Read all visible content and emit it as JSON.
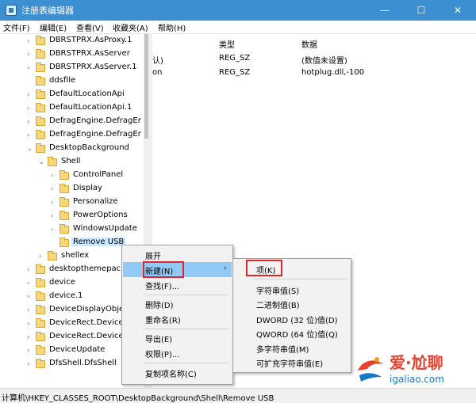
{
  "window": {
    "title": "注册表编辑器",
    "minimize_glyph": "—",
    "maximize_glyph": "☐",
    "close_glyph": "✕"
  },
  "menu": [
    "文件(F)",
    "编辑(E)",
    "查看(V)",
    "收藏夹(A)",
    "帮助(H)"
  ],
  "tree": [
    {
      "label": "DBRSTPRX.AsProxy.1",
      "depth": 0,
      "toggle": "›"
    },
    {
      "label": "DBRSTPRX.AsServer",
      "depth": 0,
      "toggle": "›"
    },
    {
      "label": "DBRSTPRX.AsServer.1",
      "depth": 0,
      "toggle": "›"
    },
    {
      "label": "ddsfile",
      "depth": 0,
      "toggle": ""
    },
    {
      "label": "DefaultLocationApi",
      "depth": 0,
      "toggle": "›"
    },
    {
      "label": "DefaultLocationApi.1",
      "depth": 0,
      "toggle": "›"
    },
    {
      "label": "DefragEngine.DefragEr",
      "depth": 0,
      "toggle": "›"
    },
    {
      "label": "DefragEngine.DefragEr",
      "depth": 0,
      "toggle": "›"
    },
    {
      "label": "DesktopBackground",
      "depth": 0,
      "toggle": "⌄"
    },
    {
      "label": "Shell",
      "depth": 1,
      "toggle": "⌄"
    },
    {
      "label": "ControlPanel",
      "depth": 2,
      "toggle": "›"
    },
    {
      "label": "Display",
      "depth": 2,
      "toggle": "›"
    },
    {
      "label": "Personalize",
      "depth": 2,
      "toggle": "›"
    },
    {
      "label": "PowerOptions",
      "depth": 2,
      "toggle": "›"
    },
    {
      "label": "WindowsUpdate",
      "depth": 2,
      "toggle": "›"
    },
    {
      "label": "Remove USB",
      "depth": 2,
      "toggle": "",
      "selected": true
    },
    {
      "label": "shellex",
      "depth": 1,
      "toggle": "›"
    },
    {
      "label": "desktopthemepac",
      "depth": 0,
      "toggle": "›"
    },
    {
      "label": "device",
      "depth": 0,
      "toggle": "›"
    },
    {
      "label": "device.1",
      "depth": 0,
      "toggle": "›"
    },
    {
      "label": "DeviceDisplayObje",
      "depth": 0,
      "toggle": "›"
    },
    {
      "label": "DeviceRect.Device",
      "depth": 0,
      "toggle": "›"
    },
    {
      "label": "DeviceRect.Device",
      "depth": 0,
      "toggle": "›"
    },
    {
      "label": "DeviceUpdate",
      "depth": 0,
      "toggle": "›"
    },
    {
      "label": "DfsShell.DfsShell",
      "depth": 0,
      "toggle": "›"
    }
  ],
  "list": {
    "headers": {
      "type": "类型",
      "data": "数据"
    },
    "rows": [
      {
        "name": "认)",
        "type": "REG_SZ",
        "data": "(数值未设置)"
      },
      {
        "name": "on",
        "type": "REG_SZ",
        "data": "hotplug.dll,-100"
      }
    ]
  },
  "context_menu": {
    "items": [
      "展开",
      "新建(N)",
      "查找(F)...",
      "删除(D)",
      "重命名(R)",
      "导出(E)",
      "权限(P)...",
      "复制项名称(C)"
    ],
    "highlighted": "新建(N)",
    "submenu_arrow": "›"
  },
  "submenu": {
    "items": [
      "项(K)",
      "字符串值(S)",
      "二进制值(B)",
      "DWORD (32 位)值(D)",
      "QWORD (64 位)值(Q)",
      "多字符串值(M)",
      "可扩充字符串值(E)"
    ]
  },
  "statusbar": {
    "path": "计算机\\HKEY_CLASSES_ROOT\\DesktopBackground\\Shell\\Remove USB"
  },
  "watermark": {
    "line1": "爱·尬聊",
    "line2": "igaliao.com"
  },
  "colors": {
    "titlebar": "#3c8fd0",
    "selection": "#cce8ff",
    "menu_highlight": "#91c9f7",
    "annotation_red": "#e0262a"
  }
}
